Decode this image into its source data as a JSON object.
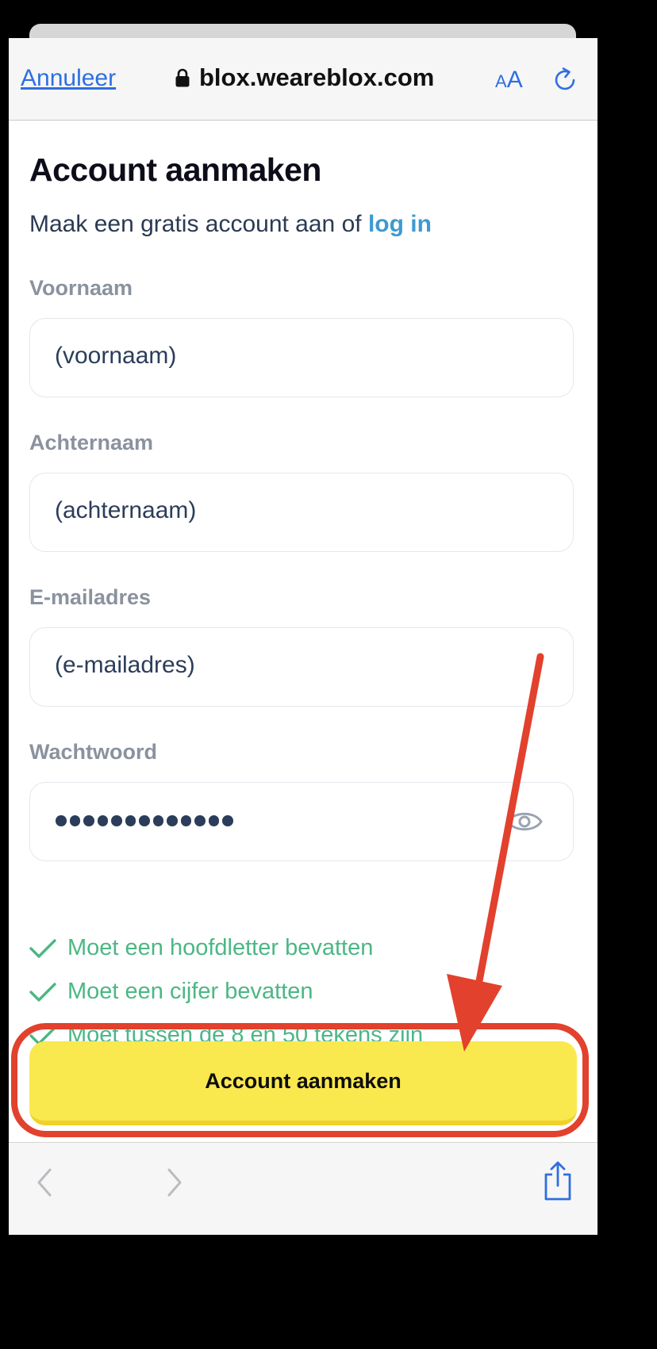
{
  "browser": {
    "cancel_label": "Annuleer",
    "url": "blox.weareblox.com",
    "text_size_small": "A",
    "text_size_big": "A"
  },
  "form": {
    "title": "Account aanmaken",
    "subtitle_text": "Maak een gratis account aan of ",
    "subtitle_link": "log in",
    "fields": [
      {
        "label": "Voornaam",
        "value": "(voornaam)"
      },
      {
        "label": "Achternaam",
        "value": "(achternaam)"
      },
      {
        "label": "E-mailadres",
        "value": "(e-mailadres)"
      },
      {
        "label": "Wachtwoord",
        "masked_length": 13
      }
    ],
    "rules": [
      "Moet een hoofdletter bevatten",
      "Moet een cijfer bevatten",
      "Moet tussen de 8 en 50 tekens zijn"
    ],
    "submit_label": "Account aanmaken"
  },
  "colors": {
    "accent": "#2f6fe0",
    "link": "#3d9ad1",
    "success": "#4cb784",
    "button": "#fae84f",
    "annotation": "#e2412d"
  },
  "icons": [
    "lock-icon",
    "text-size-icon",
    "reload-icon",
    "eye-icon",
    "check-icon",
    "back-icon",
    "forward-icon",
    "share-icon"
  ]
}
